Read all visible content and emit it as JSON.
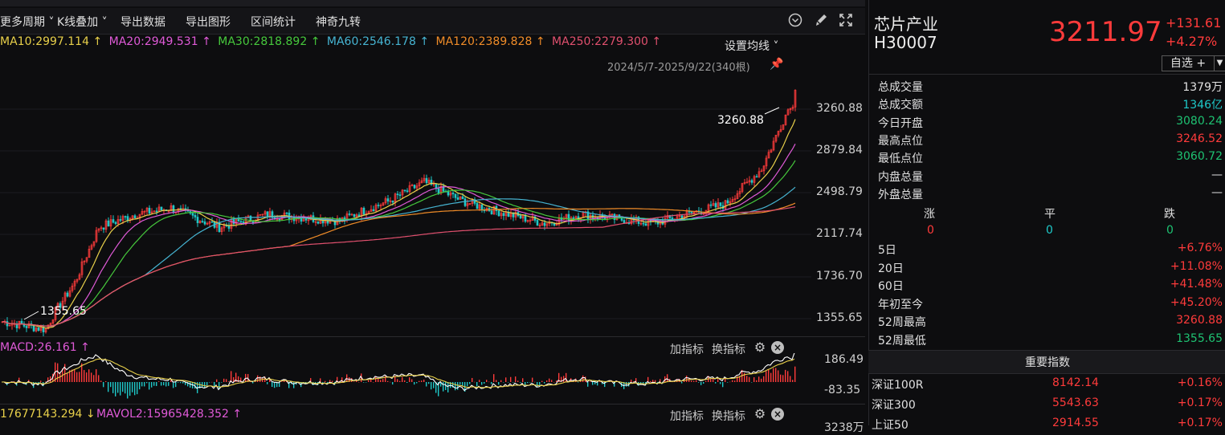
{
  "toolbar": {
    "items": [
      "更多周期",
      "K线叠加",
      "导出数据",
      "导出图形",
      "区间统计",
      "神奇九转"
    ],
    "icons": [
      "chevron-circle-icon",
      "brush-icon",
      "fullscreen-icon"
    ]
  },
  "ma": {
    "ma10": "MA10:2997.114 ↑",
    "ma20": "MA20:2949.531 ↑",
    "ma30": "MA30:2818.892 ↑",
    "ma60": "MA60:2546.178 ↑",
    "ma120": "MA120:2389.828 ↑",
    "ma250": "MA250:2279.300 ↑",
    "setting": "设置均线",
    "colors": {
      "ma10": "#e8d04a",
      "ma20": "#e05ad8",
      "ma30": "#46c83c",
      "ma60": "#46b4d2",
      "ma120": "#f08c28",
      "ma250": "#e0506e"
    }
  },
  "range": "2024/5/7-2025/9/22(340根)",
  "yaxis": [
    "3260.88",
    "2879.84",
    "2498.79",
    "2117.74",
    "1736.70",
    "1355.65"
  ],
  "annotations": {
    "high": "3260.88",
    "low": "1355.65"
  },
  "macd": {
    "title": "MACD:26.161 ↑",
    "add": "加指标",
    "switch": "换指标",
    "ymax": "186.49",
    "ymin": "-83.35"
  },
  "vol": {
    "title_a": "17677143.294 ↓",
    "title_b": "MAVOL2:15965428.352 ↑",
    "add": "加指标",
    "switch": "换指标",
    "ymax": "3238万"
  },
  "quote": {
    "name": "芯片产业",
    "code": "H30007",
    "price": "3211.97",
    "change": "+131.61",
    "pct": "+4.27%",
    "watch": "自选 +"
  },
  "stats": [
    {
      "label": "总成交量",
      "value": "1379万",
      "color": "white"
    },
    {
      "label": "总成交额",
      "value": "1346亿",
      "color": "cyan"
    },
    {
      "label": "今日开盘",
      "value": "3080.24",
      "color": "green"
    },
    {
      "label": "最高点位",
      "value": "3246.52",
      "color": "red"
    },
    {
      "label": "最低点位",
      "value": "3060.72",
      "color": "green"
    },
    {
      "label": "内盘总量",
      "value": "—",
      "color": "white"
    },
    {
      "label": "外盘总量",
      "value": "—",
      "color": "white"
    }
  ],
  "breadth": {
    "up_label": "涨",
    "flat_label": "平",
    "down_label": "跌",
    "up": "0",
    "flat": "0",
    "down": "0"
  },
  "periods": [
    {
      "label": "5日",
      "value": "+6.76%"
    },
    {
      "label": "20日",
      "value": "+11.08%"
    },
    {
      "label": "60日",
      "value": "+41.48%"
    },
    {
      "label": "年初至今",
      "value": "+45.20%"
    },
    {
      "label": "52周最高",
      "value": "3260.88"
    },
    {
      "label": "52周最低",
      "value": "1355.65"
    }
  ],
  "index_header": "重要指数",
  "indices": [
    {
      "name": "深证100R",
      "price": "8142.14",
      "pct": "+0.16%"
    },
    {
      "name": "深证300",
      "price": "5543.63",
      "pct": "+0.17%"
    },
    {
      "name": "上证50",
      "price": "2914.55",
      "pct": "+0.17%"
    }
  ]
}
